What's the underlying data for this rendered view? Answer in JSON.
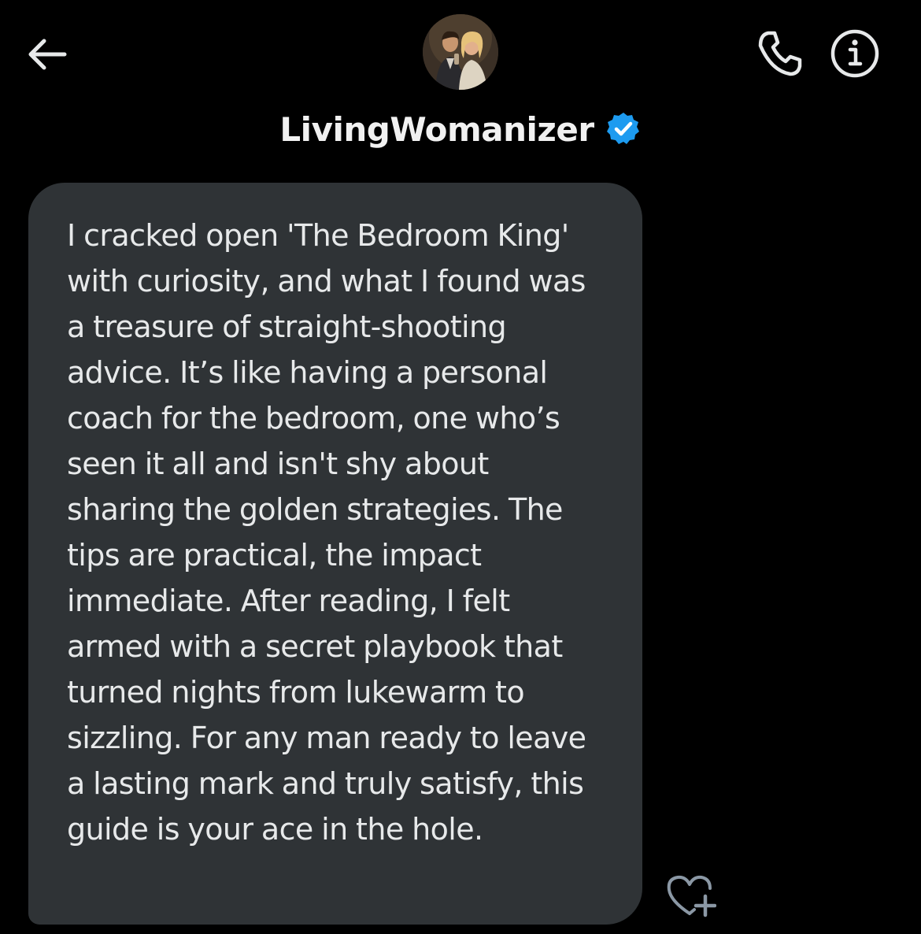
{
  "header": {
    "title": "LivingWomanizer",
    "verified": true,
    "back_icon": "arrow-left-icon",
    "call_icon": "phone-icon",
    "info_icon": "info-icon",
    "avatar_icon": "avatar-image"
  },
  "message": {
    "text": "I cracked open 'The Bedroom King' with curiosity, and what I found was a treasure of straight-shooting advice. It’s like having a personal coach for the bedroom, one who’s seen it all and isn't shy about sharing the golden strategies. The tips are practical, the impact immediate. After reading, I felt armed with a secret playbook that turned nights from lukewarm to sizzling. For any man ready to leave a lasting mark and truly satisfy, this guide is your ace in the hole."
  },
  "colors": {
    "background": "#000000",
    "bubble": "#2f3336",
    "text": "#e7e9ea",
    "verified": "#1d9bf0"
  }
}
